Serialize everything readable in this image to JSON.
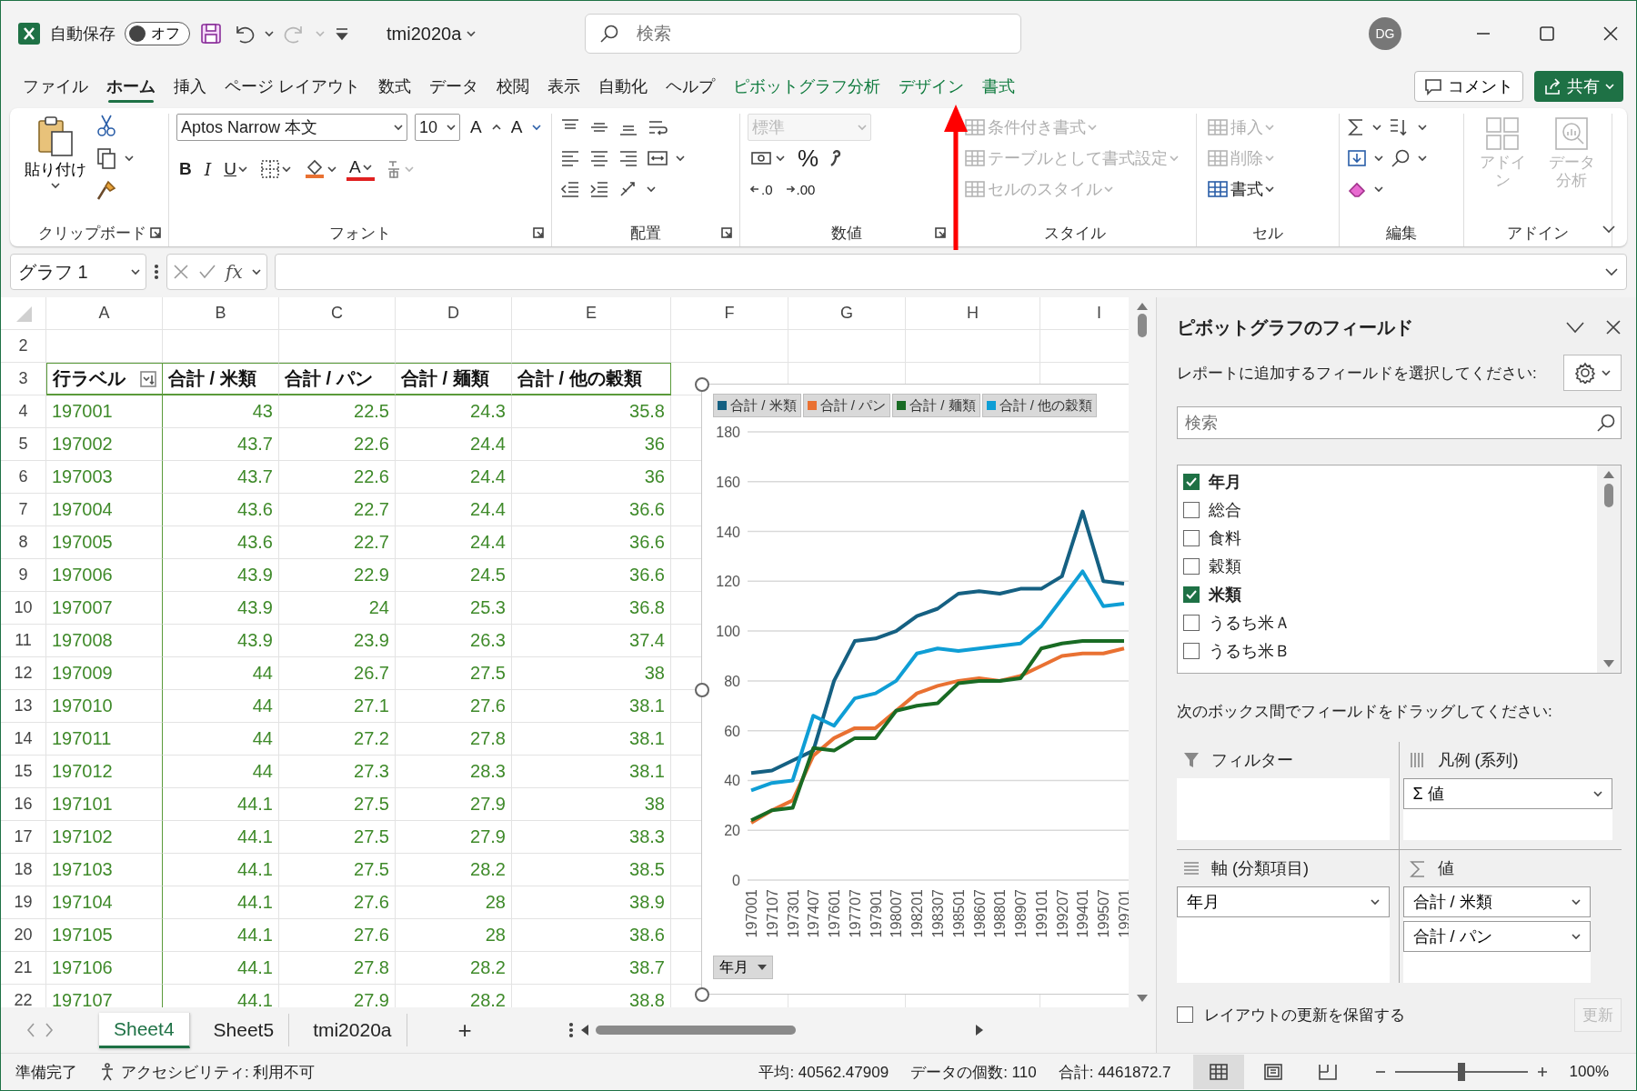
{
  "title_bar": {
    "autosave_label": "自動保存",
    "autosave_toggle": {
      "label": "オフ",
      "on": false
    },
    "file_name": "tmi2020a",
    "search": {
      "placeholder": "検索"
    },
    "avatar": "DG"
  },
  "menu_tabs": [
    {
      "label": "ファイル",
      "selected": false,
      "kind": "standard"
    },
    {
      "label": "ホーム",
      "selected": true,
      "kind": "standard"
    },
    {
      "label": "挿入",
      "selected": false,
      "kind": "standard"
    },
    {
      "label": "ページ レイアウト",
      "selected": false,
      "kind": "standard"
    },
    {
      "label": "数式",
      "selected": false,
      "kind": "standard"
    },
    {
      "label": "データ",
      "selected": false,
      "kind": "standard"
    },
    {
      "label": "校閲",
      "selected": false,
      "kind": "standard"
    },
    {
      "label": "表示",
      "selected": false,
      "kind": "standard"
    },
    {
      "label": "自動化",
      "selected": false,
      "kind": "standard"
    },
    {
      "label": "ヘルプ",
      "selected": false,
      "kind": "standard"
    },
    {
      "label": "ピボットグラフ分析",
      "selected": false,
      "kind": "contextual"
    },
    {
      "label": "デザイン",
      "selected": false,
      "kind": "contextual"
    },
    {
      "label": "書式",
      "selected": false,
      "kind": "contextual"
    }
  ],
  "comment_button": "コメント",
  "share_button": "共有",
  "ribbon": [
    {
      "kind": "clipboard",
      "label": "クリップボード",
      "paste": "貼り付け"
    },
    {
      "kind": "font",
      "label": "フォント",
      "font_name": "Aptos Narrow 本文",
      "font_size": "10",
      "grow": "A",
      "shrink": "A",
      "bold": "B",
      "italic": "I",
      "underline": "U",
      "font_color": "A"
    },
    {
      "kind": "alignment",
      "label": "配置"
    },
    {
      "kind": "number",
      "label": "数値",
      "format": {
        "value": "標準",
        "disabled": true
      },
      "percent": "%",
      "increase_decimal": ".0",
      "decrease_decimal": ".00"
    },
    {
      "kind": "styles",
      "label": "スタイル",
      "items": [
        {
          "label": "条件付き書式",
          "disabled": true
        },
        {
          "label": "テーブルとして書式設定",
          "disabled": true
        },
        {
          "label": "セルのスタイル",
          "disabled": true
        }
      ]
    },
    {
      "kind": "cells",
      "label": "セル",
      "items": [
        {
          "label": "挿入",
          "disabled": true
        },
        {
          "label": "削除",
          "disabled": true
        },
        {
          "label": "書式",
          "disabled": false
        }
      ]
    },
    {
      "kind": "editing",
      "label": "編集"
    },
    {
      "kind": "addins",
      "label": "アドイン",
      "items": [
        {
          "label": "アドイン",
          "disabled": true
        },
        {
          "label": "データ分析",
          "disabled": true
        }
      ]
    }
  ],
  "pointer_arrow": {
    "kind": "arrow"
  },
  "formula_bar": {
    "name_box": "グラフ 1",
    "fx": "fx"
  },
  "sheet": {
    "columns": [
      "A",
      "B",
      "C",
      "D",
      "E",
      "F",
      "G",
      "H",
      "I"
    ],
    "row_numbers": [
      "2",
      "3",
      "4",
      "5",
      "6",
      "7",
      "8",
      "9",
      "10",
      "11",
      "12",
      "13",
      "14",
      "15",
      "16",
      "17",
      "18",
      "19",
      "20",
      "21",
      "22"
    ],
    "header": [
      "行ラベル",
      "合計 / 米類",
      "合計 / パン",
      "合計 / 麺類",
      "合計 / 他の穀類"
    ],
    "rows": [
      [
        "197001",
        "43",
        "22.5",
        "24.3",
        "35.8"
      ],
      [
        "197002",
        "43.7",
        "22.6",
        "24.4",
        "36"
      ],
      [
        "197003",
        "43.7",
        "22.6",
        "24.4",
        "36"
      ],
      [
        "197004",
        "43.6",
        "22.7",
        "24.4",
        "36.6"
      ],
      [
        "197005",
        "43.6",
        "22.7",
        "24.4",
        "36.6"
      ],
      [
        "197006",
        "43.9",
        "22.9",
        "24.5",
        "36.6"
      ],
      [
        "197007",
        "43.9",
        "24",
        "25.3",
        "36.8"
      ],
      [
        "197008",
        "43.9",
        "23.9",
        "26.3",
        "37.4"
      ],
      [
        "197009",
        "44",
        "26.7",
        "27.5",
        "38"
      ],
      [
        "197010",
        "44",
        "27.1",
        "27.6",
        "38.1"
      ],
      [
        "197011",
        "44",
        "27.2",
        "27.8",
        "38.1"
      ],
      [
        "197012",
        "44",
        "27.3",
        "28.3",
        "38.1"
      ],
      [
        "197101",
        "44.1",
        "27.5",
        "27.9",
        "38"
      ],
      [
        "197102",
        "44.1",
        "27.5",
        "27.9",
        "38.3"
      ],
      [
        "197103",
        "44.1",
        "27.5",
        "28.2",
        "38.5"
      ],
      [
        "197104",
        "44.1",
        "27.6",
        "28",
        "38.9"
      ],
      [
        "197105",
        "44.1",
        "27.6",
        "28",
        "38.6"
      ],
      [
        "197106",
        "44.1",
        "27.8",
        "28.2",
        "38.7"
      ],
      [
        "197107",
        "44.1",
        "27.9",
        "28.2",
        "38.8"
      ]
    ]
  },
  "chart": {
    "axis_field_button": "年月",
    "chart_data": {
      "type": "line",
      "categories": [
        "197001",
        "197107",
        "197301",
        "197407",
        "197601",
        "197707",
        "197901",
        "198007",
        "198201",
        "198307",
        "198501",
        "198607",
        "198801",
        "198907",
        "199101",
        "199207",
        "199401",
        "199507",
        "199701"
      ],
      "series": [
        {
          "name": "合計 / 米類",
          "color": "#156082",
          "values": [
            43,
            44,
            48,
            52,
            80,
            96,
            97,
            100,
            106,
            109,
            115,
            116,
            115,
            117,
            117,
            122,
            148,
            120,
            119
          ]
        },
        {
          "name": "合計 / パン",
          "color": "#e97132",
          "values": [
            23,
            28,
            32,
            50,
            57,
            61,
            61,
            68,
            75,
            78,
            80,
            81,
            80,
            82,
            86,
            90,
            91,
            91,
            93
          ]
        },
        {
          "name": "合計 / 麺類",
          "color": "#196b24",
          "values": [
            24,
            28,
            29,
            53,
            52,
            57,
            57,
            68,
            70,
            71,
            79,
            80,
            80,
            81,
            93,
            95,
            96,
            96,
            96
          ]
        },
        {
          "name": "合計 / 他の穀類",
          "color": "#0f9ed5",
          "values": [
            36,
            39,
            40,
            66,
            62,
            73,
            75,
            80,
            91,
            93,
            92,
            93,
            94,
            95,
            102,
            113,
            124,
            110,
            111
          ]
        }
      ],
      "grid": true,
      "legend": "top",
      "ylim": [
        0,
        180
      ],
      "yticks": [
        0,
        20,
        40,
        60,
        80,
        100,
        120,
        140,
        160,
        180
      ]
    }
  },
  "sheet_tabs": [
    {
      "label": "Sheet4",
      "selected": true
    },
    {
      "label": "Sheet5",
      "selected": false
    },
    {
      "label": "tmi2020a",
      "selected": false
    }
  ],
  "add_sheet": "+",
  "pivot_pane": {
    "title": "ピボットグラフのフィールド",
    "instruction": "レポートに追加するフィールドを選択してください:",
    "search": {
      "placeholder": "検索"
    },
    "fields": [
      {
        "label": "年月",
        "checked": true
      },
      {
        "label": "総合",
        "checked": false
      },
      {
        "label": "食料",
        "checked": false
      },
      {
        "label": "穀類",
        "checked": false
      },
      {
        "label": "米類",
        "checked": true
      },
      {
        "label": "うるち米Ａ",
        "checked": false
      },
      {
        "label": "うるち米Ｂ",
        "checked": false
      }
    ],
    "drag_instruction": "次のボックス間でフィールドをドラッグしてください:",
    "areas": [
      {
        "kind": "filter",
        "label": "フィルター"
      },
      {
        "kind": "legend",
        "label": "凡例 (系列)",
        "items": [
          "Σ 値"
        ]
      },
      {
        "kind": "axis",
        "label": "軸 (分類項目)",
        "items": [
          "年月"
        ]
      },
      {
        "kind": "values",
        "label": "値",
        "items": [
          "合計 / 米類",
          "合計 / パン"
        ]
      }
    ],
    "defer_update": {
      "label": "レイアウトの更新を保留する",
      "checked": false
    },
    "update_button": {
      "label": "更新",
      "disabled": true
    }
  },
  "status_bar": {
    "ready": "準備完了",
    "accessibility": "アクセシビリティ: 利用不可",
    "average": "平均: 40562.47909",
    "count": "データの個数: 110",
    "sum": "合計: 4461872.7",
    "views": [
      {
        "selected": true
      },
      {
        "selected": false
      },
      {
        "selected": false
      }
    ],
    "zoom": {
      "level": 0.5,
      "label": "100%"
    }
  }
}
